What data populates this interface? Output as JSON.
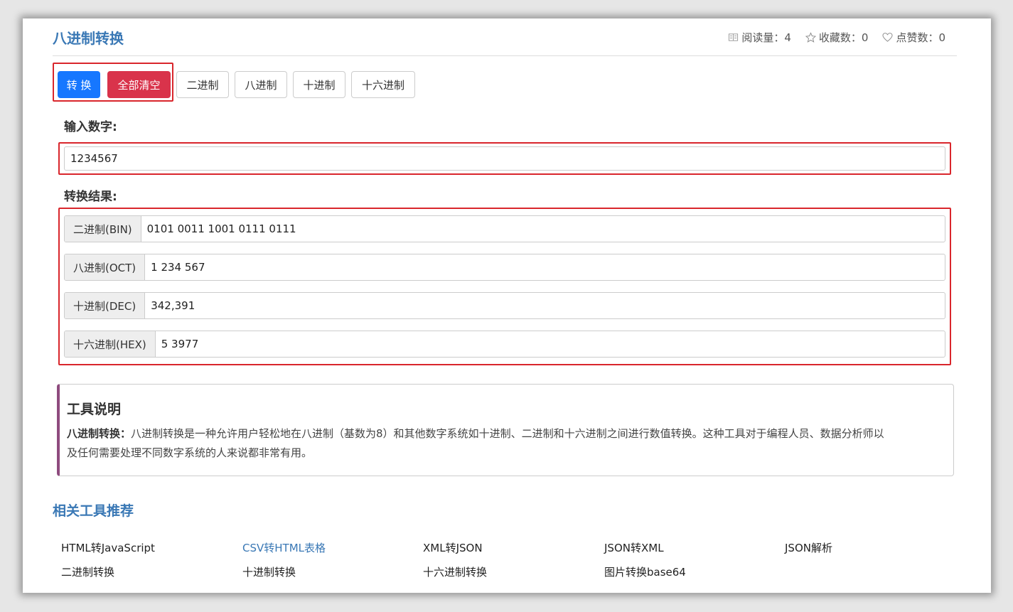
{
  "header": {
    "title": "八进制转换",
    "stats": {
      "read": "阅读量：4",
      "fav": "收藏数：0",
      "like": "点赞数：0"
    }
  },
  "toolbar": {
    "convert": "转 换",
    "clear": "全部清空",
    "bin": "二进制",
    "oct": "八进制",
    "dec": "十进制",
    "hex": "十六进制"
  },
  "input": {
    "label": "输入数字:",
    "value": "1234567"
  },
  "results": {
    "label": "转换结果:",
    "rows": [
      {
        "name": "二进制(BIN)",
        "value": "0101 0011 1001 0111 0111"
      },
      {
        "name": "八进制(OCT)",
        "value": "1 234 567"
      },
      {
        "name": "十进制(DEC)",
        "value": "342,391"
      },
      {
        "name": "十六进制(HEX)",
        "value": "5 3977"
      }
    ]
  },
  "description": {
    "title": "工具说明",
    "lead": "八进制转换：",
    "text1": "八进制转换是一种允许用户轻松地在八进制（基数为8）和其他数字系统如十进制、二进制和十六进制之间进行数值转换。这种工具对于编程人员、数据分析师以",
    "text2": "及任何需要处理不同数字系统的人来说都非常有用。"
  },
  "related": {
    "title": "相关工具推荐",
    "links": [
      "HTML转JavaScript",
      "CSV转HTML表格",
      "XML转JSON",
      "JSON转XML",
      "JSON解析",
      "二进制转换",
      "十进制转换",
      "十六进制转换",
      "图片转换base64"
    ]
  },
  "colors": {
    "accent": "#3a78b5",
    "primary": "#1677ff",
    "danger": "#d9334b",
    "highlight": "#d9262c"
  }
}
